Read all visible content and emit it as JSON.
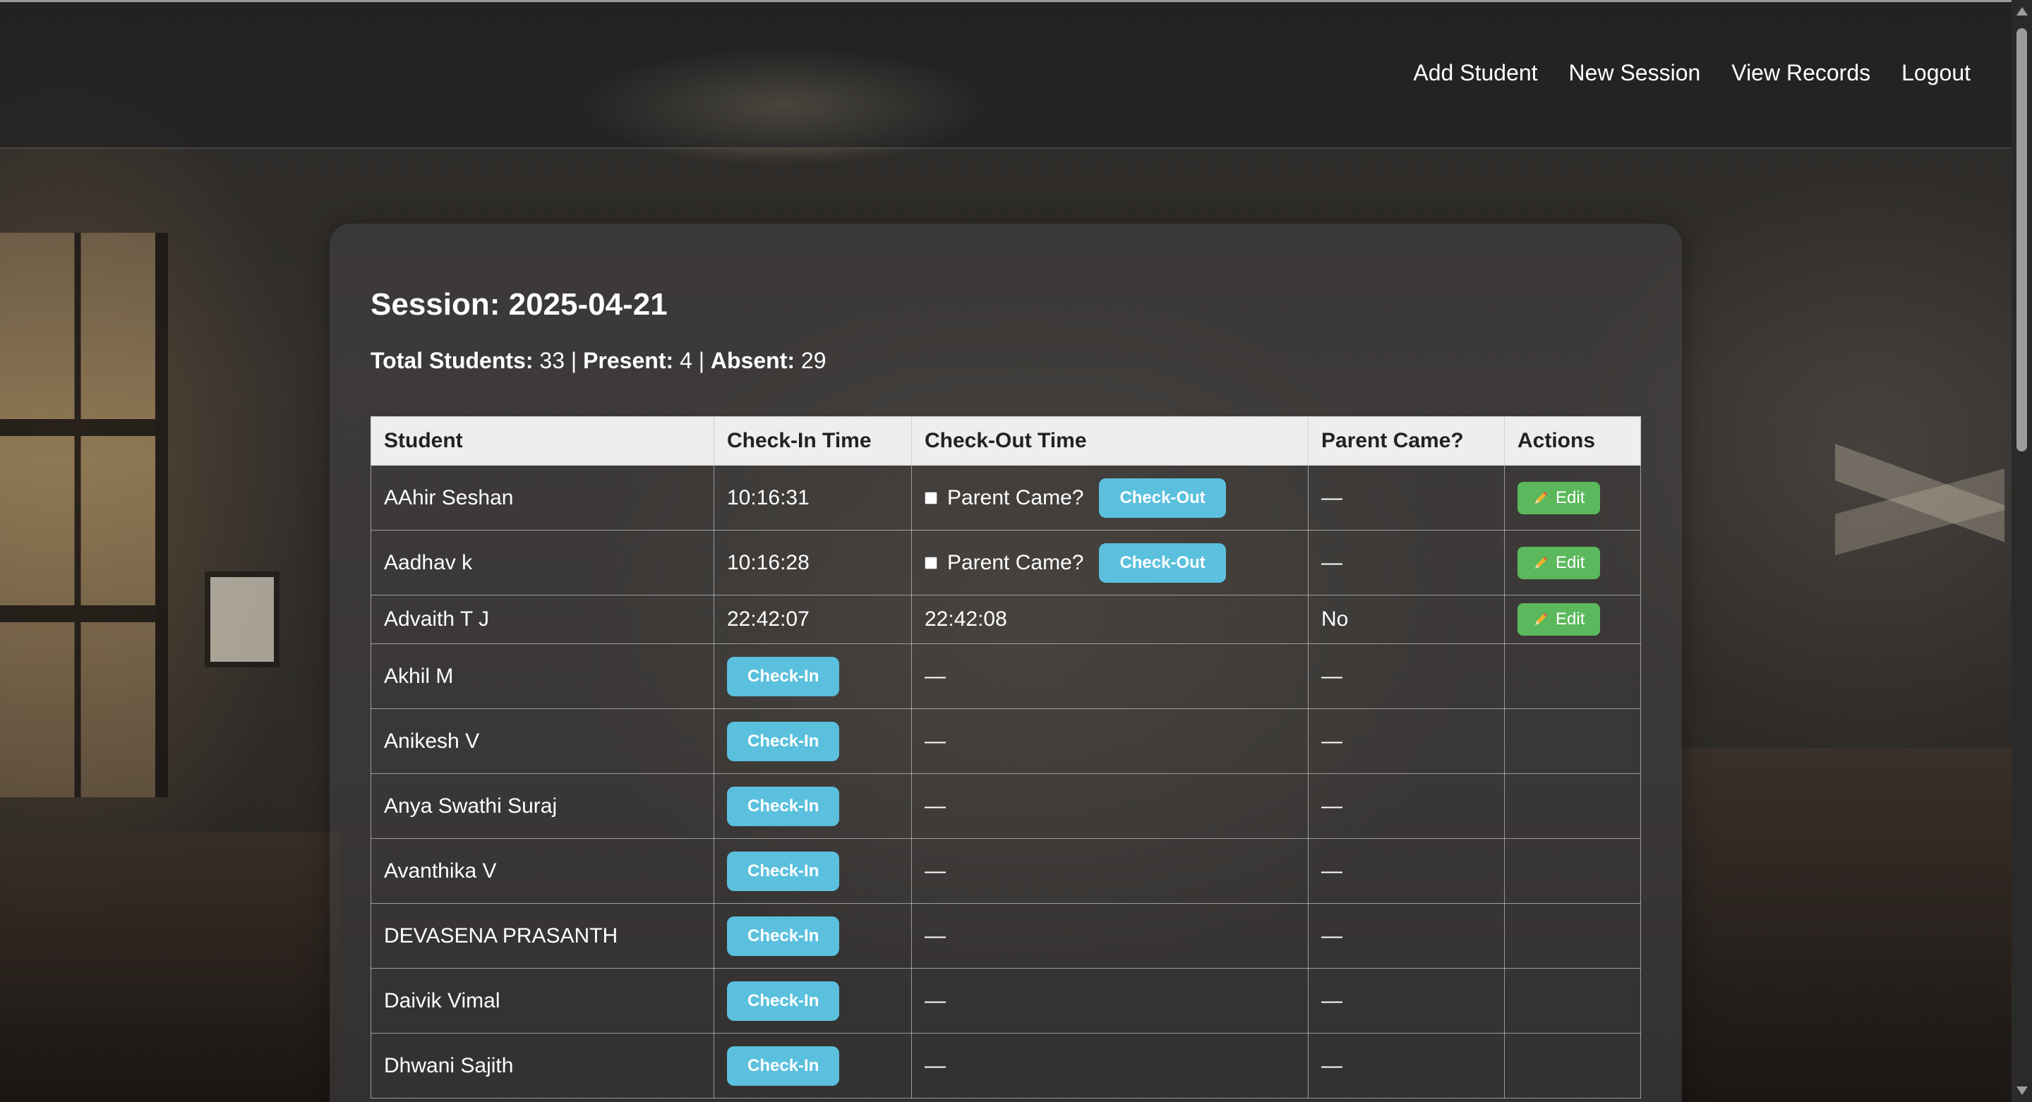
{
  "nav": {
    "links": [
      "Add Student",
      "New Session",
      "View Records",
      "Logout"
    ]
  },
  "session": {
    "title": "Session: 2025-04-21",
    "total_label": "Total Students:",
    "total_value": "33",
    "present_label": "Present:",
    "present_value": "4",
    "absent_label": "Absent:",
    "absent_value": "29",
    "separator": "|"
  },
  "table": {
    "headers": [
      "Student",
      "Check-In Time",
      "Check-Out Time",
      "Parent Came?",
      "Actions"
    ],
    "buttons": {
      "checkin": "Check-In",
      "checkout": "Check-Out",
      "edit": "Edit",
      "parent_came_label": "Parent Came?"
    },
    "dash": "—",
    "rows": [
      {
        "student": "AAhir Seshan",
        "checkin": "10:16:31",
        "checkout": null,
        "parent": "—",
        "state": "checked-in"
      },
      {
        "student": "Aadhav k",
        "checkin": "10:16:28",
        "checkout": null,
        "parent": "—",
        "state": "checked-in"
      },
      {
        "student": "Advaith T J",
        "checkin": "22:42:07",
        "checkout": "22:42:08",
        "parent": "No",
        "state": "checked-out"
      },
      {
        "student": "Akhil M",
        "checkin": null,
        "checkout": "—",
        "parent": "—",
        "state": "absent"
      },
      {
        "student": "Anikesh V",
        "checkin": null,
        "checkout": "—",
        "parent": "—",
        "state": "absent"
      },
      {
        "student": "Anya Swathi Suraj",
        "checkin": null,
        "checkout": "—",
        "parent": "—",
        "state": "absent"
      },
      {
        "student": "Avanthika V",
        "checkin": null,
        "checkout": "—",
        "parent": "—",
        "state": "absent"
      },
      {
        "student": "DEVASENA PRASANTH",
        "checkin": null,
        "checkout": "—",
        "parent": "—",
        "state": "absent"
      },
      {
        "student": "Daivik Vimal",
        "checkin": null,
        "checkout": "—",
        "parent": "—",
        "state": "absent"
      },
      {
        "student": "Dhwani Sajith",
        "checkin": null,
        "checkout": "—",
        "parent": "—",
        "state": "absent"
      }
    ]
  },
  "colors": {
    "info_button": "#5bc0de",
    "edit_button": "#5cb85c",
    "header_bg": "#eeeeee"
  },
  "icons": {
    "edit": "pencil-icon"
  }
}
